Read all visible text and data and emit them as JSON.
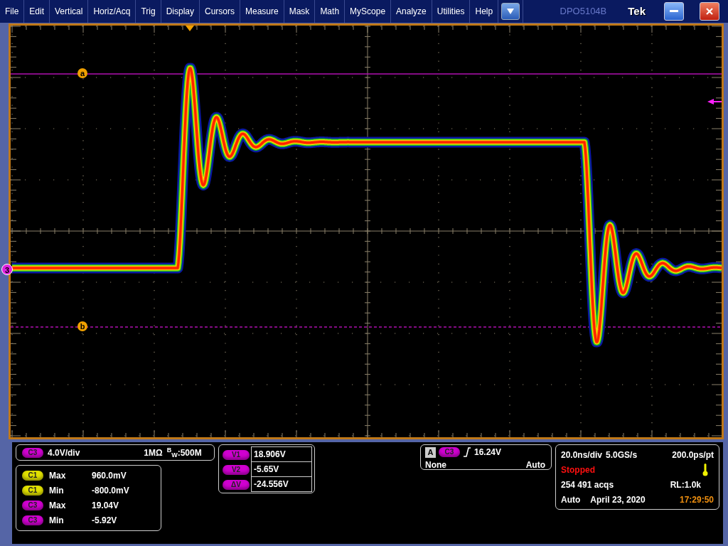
{
  "menu": [
    {
      "label": "File"
    },
    {
      "label": "Edit"
    },
    {
      "label": "Vertical"
    },
    {
      "label": "Horiz/Acq"
    },
    {
      "label": "Trig"
    },
    {
      "label": "Display"
    },
    {
      "label": "Cursors"
    },
    {
      "label": "Measure"
    },
    {
      "label": "Mask"
    },
    {
      "label": "Math"
    },
    {
      "label": "MyScope"
    },
    {
      "label": "Analyze"
    },
    {
      "label": "Utilities"
    },
    {
      "label": "Help"
    }
  ],
  "title_bar": {
    "model": "DPO5104B",
    "brand": "Tek"
  },
  "display": {
    "cursors": [
      {
        "label": "a",
        "kind": "solid"
      },
      {
        "label": "b",
        "kind": "dashed"
      }
    ],
    "channel_marker": "3"
  },
  "channel": {
    "badge": "C3",
    "scale": "4.0V/div",
    "impedance": "1MΩ",
    "bandwidth": "$^{B}$$_{W}$:500M"
  },
  "measurements": [
    {
      "badge": "C1",
      "color": "#e0e000",
      "stat": "Max",
      "value": "960.0mV"
    },
    {
      "badge": "C1",
      "color": "#e0e000",
      "stat": "Min",
      "value": "-800.0mV"
    },
    {
      "badge": "C3",
      "color": "#d000d0",
      "stat": "Max",
      "value": "19.04V"
    },
    {
      "badge": "C3",
      "color": "#d000d0",
      "stat": "Min",
      "value": "-5.92V"
    }
  ],
  "cursor_readouts": [
    {
      "badge": "V1",
      "value": "18.906V"
    },
    {
      "badge": "V2",
      "value": "-5.65V"
    },
    {
      "badge": "ΔV",
      "value": "-24.556V"
    }
  ],
  "trigger": {
    "event": "A",
    "badge": "C3",
    "level": "16.24V",
    "coupling": "None",
    "mode": "Auto"
  },
  "horizontal": {
    "scale": "20.0ns/div",
    "sample_rate": "5.0GS/s",
    "resolution": "200.0ps/pt",
    "state": "Stopped",
    "acquisitions": "254 491 acqs",
    "record_length": "RL:1.0k",
    "mode": "Auto",
    "date": "April 23, 2020",
    "time": "17:29:50"
  }
}
